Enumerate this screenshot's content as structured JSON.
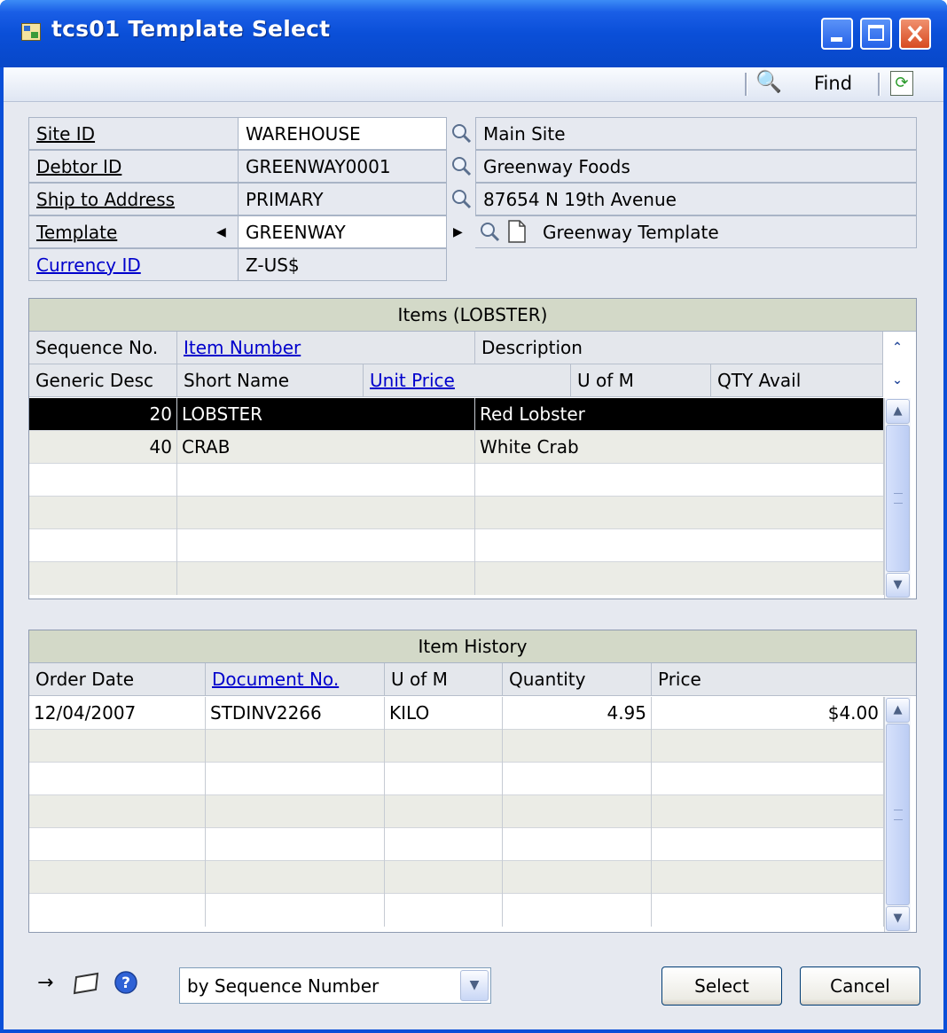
{
  "window": {
    "title": "tcs01 Template Select",
    "controls": {
      "minimize": "minimize-icon",
      "maximize": "maximize-icon",
      "close": "close-icon"
    }
  },
  "toolbar": {
    "find_label": "Find",
    "find_icon": "binoculars-icon",
    "refresh_icon": "refresh-icon"
  },
  "fields": {
    "site_id": {
      "label": "Site ID",
      "value": "WAREHOUSE",
      "description": "Main Site"
    },
    "debtor_id": {
      "label": "Debtor ID",
      "value": "GREENWAY0001",
      "description": "Greenway Foods"
    },
    "ship_to": {
      "label": "Ship to Address",
      "value": "PRIMARY",
      "description": "87654 N 19th Avenue"
    },
    "template": {
      "label": "Template",
      "value": "GREENWAY",
      "description": "Greenway Template"
    },
    "currency": {
      "label": "Currency ID",
      "value": "Z-US$"
    }
  },
  "items_grid": {
    "title": "Items (LOBSTER)",
    "header_row1": [
      "Sequence No.",
      "Item Number",
      "Description"
    ],
    "header_row2": [
      "Generic Desc",
      "Short Name",
      "Unit Price",
      "U of M",
      "QTY Avail"
    ],
    "rows": [
      {
        "seq": "20",
        "item": "LOBSTER",
        "desc": "Red Lobster"
      },
      {
        "seq": "40",
        "item": "CRAB",
        "desc": "White Crab"
      },
      {
        "seq": "",
        "item": "",
        "desc": ""
      },
      {
        "seq": "",
        "item": "",
        "desc": ""
      },
      {
        "seq": "",
        "item": "",
        "desc": ""
      },
      {
        "seq": "",
        "item": "",
        "desc": ""
      }
    ]
  },
  "history_grid": {
    "title": "Item History",
    "headers": [
      "Order Date",
      "Document No.",
      "U of M",
      "Quantity",
      "Price"
    ],
    "rows": [
      {
        "date": "12/04/2007",
        "doc": "STDINV2266",
        "uom": "KILO",
        "qty": "4.95",
        "price": "$4.00"
      },
      {
        "date": "",
        "doc": "",
        "uom": "",
        "qty": "",
        "price": ""
      },
      {
        "date": "",
        "doc": "",
        "uom": "",
        "qty": "",
        "price": ""
      },
      {
        "date": "",
        "doc": "",
        "uom": "",
        "qty": "",
        "price": ""
      },
      {
        "date": "",
        "doc": "",
        "uom": "",
        "qty": "",
        "price": ""
      },
      {
        "date": "",
        "doc": "",
        "uom": "",
        "qty": "",
        "price": ""
      },
      {
        "date": "",
        "doc": "",
        "uom": "",
        "qty": "",
        "price": ""
      }
    ]
  },
  "footer": {
    "sort_value": "by Sequence Number",
    "select_label": "Select",
    "cancel_label": "Cancel",
    "icons": [
      "pin-icon",
      "note-icon",
      "help-icon"
    ]
  },
  "colors": {
    "title_bar": "#0a4fd8",
    "link": "#0000cc",
    "selected_row": "#000000"
  }
}
